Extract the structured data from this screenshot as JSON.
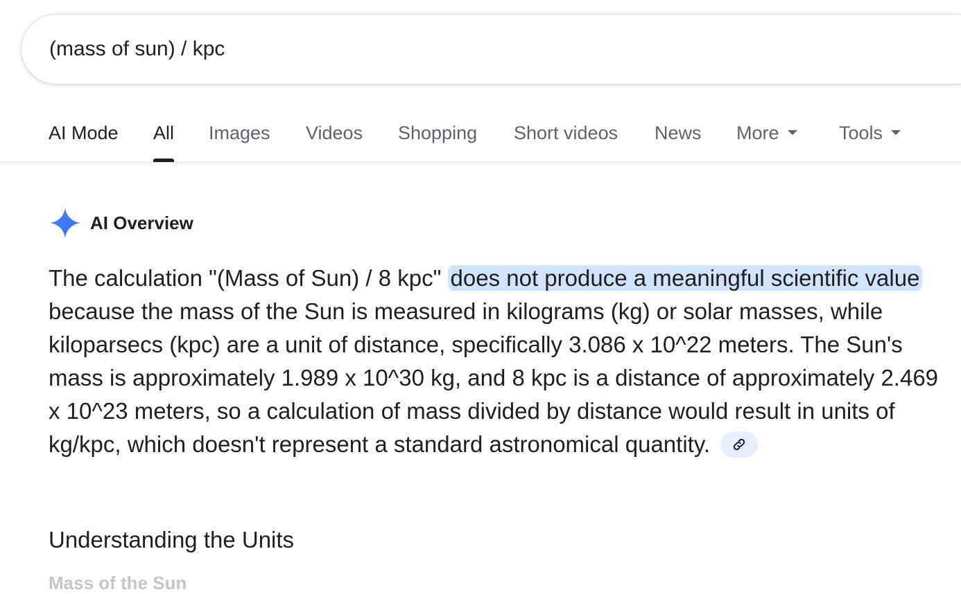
{
  "search": {
    "query": "(mass of sun) / kpc"
  },
  "tabs": [
    {
      "label": "AI Mode"
    },
    {
      "label": "All"
    },
    {
      "label": "Images"
    },
    {
      "label": "Videos"
    },
    {
      "label": "Shopping"
    },
    {
      "label": "Short videos"
    },
    {
      "label": "News"
    },
    {
      "label": "More"
    },
    {
      "label": "Tools"
    }
  ],
  "active_tab": "All",
  "ai_overview": {
    "title": "AI Overview",
    "text_before": "The calculation \"(Mass of Sun) / 8 kpc\" ",
    "highlight": "does not produce a meaningful scientific value",
    "text_after": " because the mass of the Sun is measured in kilograms (kg) or solar masses, while kiloparsecs (kpc) are a unit of distance, specifically 3.086 x 10^22 meters. The Sun's mass is approximately 1.989 x 10^30 kg, and 8 kpc is a distance of approximately 2.469 x 10^23 meters, so a calculation of mass divided by distance would result in units of kg/kpc, which doesn't represent a standard astronomical quantity.",
    "link_icon": "link-icon",
    "section_heading": "Understanding the Units",
    "subsection_heading": "Mass of the Sun"
  },
  "colors": {
    "accent": "#4285f4",
    "highlight": "#d3e3fd",
    "text": "#1f1f1f",
    "muted": "#5f6368"
  }
}
